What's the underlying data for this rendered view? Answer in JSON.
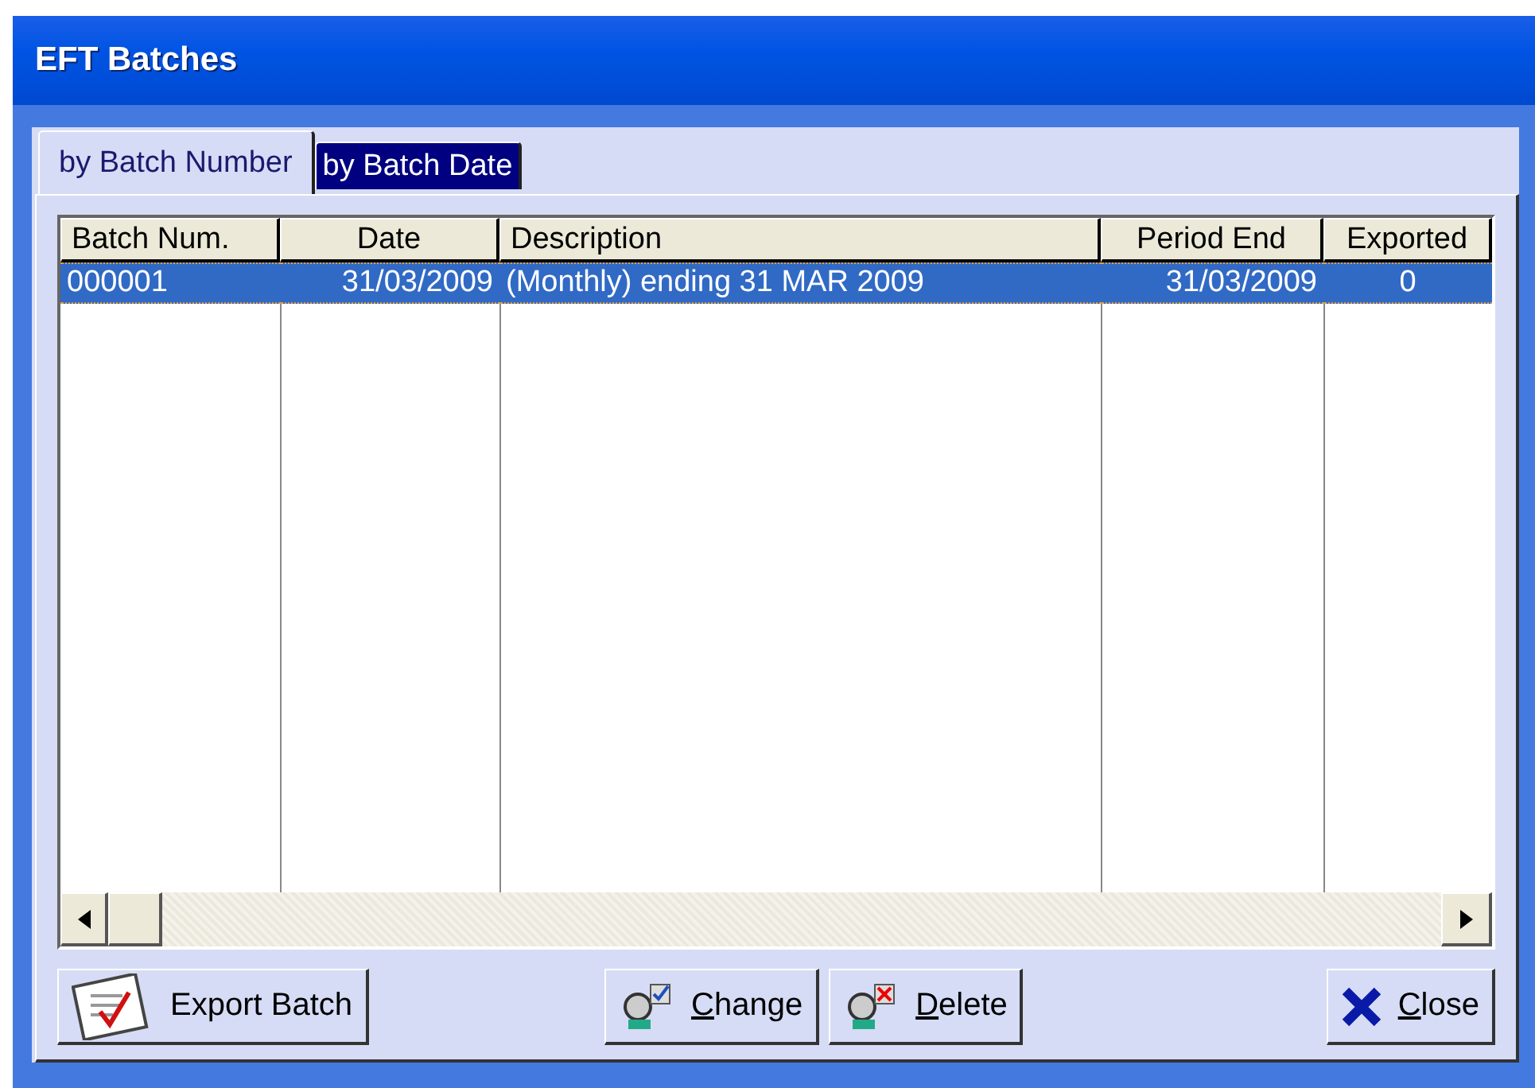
{
  "window": {
    "title": "EFT Batches"
  },
  "tabs": [
    {
      "label": "by Batch Number",
      "selected": true
    },
    {
      "label": "by Batch Date",
      "selected": false
    }
  ],
  "table": {
    "columns": [
      {
        "label": "Batch Num."
      },
      {
        "label": "Date"
      },
      {
        "label": "Description"
      },
      {
        "label": "Period End"
      },
      {
        "label": "Exported"
      }
    ],
    "rows": [
      {
        "selected": true,
        "cells": [
          "000001",
          "31/03/2009",
          "(Monthly) ending 31 MAR 2009",
          "31/03/2009",
          "0"
        ]
      }
    ]
  },
  "buttons": [
    {
      "label": "Export Batch",
      "kind": "export",
      "underline_first": false
    },
    {
      "label": "Change",
      "kind": "change",
      "underline_first": true
    },
    {
      "label": "Delete",
      "kind": "delete",
      "underline_first": true
    },
    {
      "label": "Close",
      "kind": "close",
      "underline_first": true
    }
  ]
}
